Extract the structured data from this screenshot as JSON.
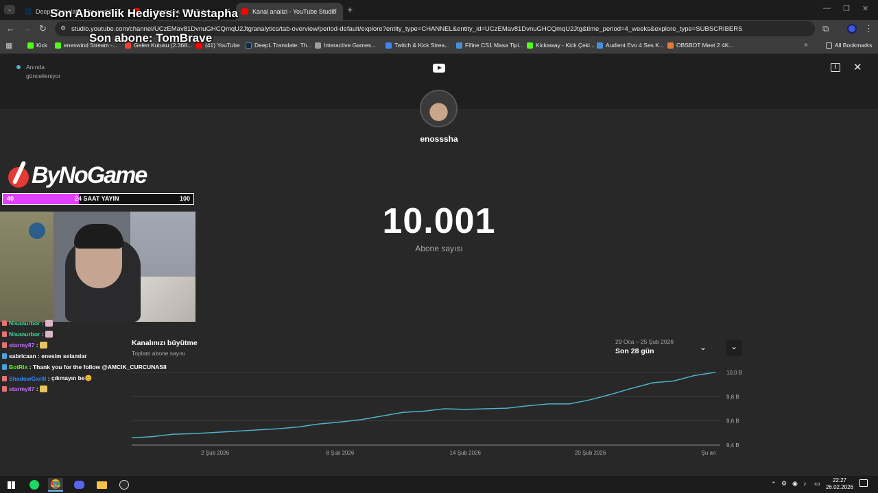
{
  "browser": {
    "tabs": [
      {
        "title": "DeepL Translate: The world's ..."
      },
      {
        "title": "(1) enosssha - YouTube"
      },
      {
        "title": "Kanal analizi - YouTube Studio"
      }
    ],
    "url": "studio.youtube.com/channel/UCzEMav81DvnuGHCQmqU2Jtg/analytics/tab-overview/period-default/explore?entity_type=CHANNEL&entity_id=UCzEMav81DvnuGHCQmqU2Jtg&time_period=4_weeks&explore_type=SUBSCRIBERS",
    "bookmarks": [
      {
        "label": "Kick",
        "color": "#53fc18"
      },
      {
        "label": "eneswind Stream -...",
        "color": "#53fc18"
      },
      {
        "label": "Gelen Kutusu (2.368...",
        "color": "#ea4335"
      },
      {
        "label": "(41) YouTube",
        "color": "#ff0000"
      },
      {
        "label": "DeepL Translate: Th...",
        "color": "#0f2b46"
      },
      {
        "label": "Interactive Games...",
        "color": "#9aa0a6"
      },
      {
        "label": "Twitch & Kick Strea...",
        "color": "#4285f4"
      },
      {
        "label": "Fifine CS1 Masa Tipi...",
        "color": "#4a90d9"
      },
      {
        "label": "Kickaway - Kick Çeki...",
        "color": "#53fc18"
      },
      {
        "label": "Audient Evo 4 Ses K...",
        "color": "#4a90d9"
      },
      {
        "label": "OBSBOT Meet 2 4K...",
        "color": "#e07b39"
      }
    ],
    "all_bookmarks": "All Bookmarks"
  },
  "studio": {
    "live_label_1": "Anında",
    "live_label_2": "güncelleniyor",
    "channel_name": "enosssha",
    "subscriber_count": "10.001",
    "subscriber_label": "Abone sayısı",
    "card_title": "Kanalınızı büyütme",
    "card_subtitle": "Toplam abone sayısı",
    "date_range": "29 Oca – 25 Şub 2026",
    "period_label": "Son 28 gün"
  },
  "chart_data": {
    "type": "line",
    "title": "Kanalınızı büyütme",
    "x_tick_labels": [
      "2 Şub 2026",
      "8 Şub 2026",
      "14 Şub 2026",
      "20 Şub 2026",
      "Şu an"
    ],
    "y_tick_labels": [
      "10,0 B",
      "9,8 B",
      "9,6 B",
      "9,4 B"
    ],
    "ylim": [
      9400,
      10000
    ],
    "x": [
      "29 Oca",
      "30 Oca",
      "31 Oca",
      "1 Şub",
      "2 Şub",
      "3 Şub",
      "4 Şub",
      "5 Şub",
      "6 Şub",
      "7 Şub",
      "8 Şub",
      "9 Şub",
      "10 Şub",
      "11 Şub",
      "12 Şub",
      "13 Şub",
      "14 Şub",
      "15 Şub",
      "16 Şub",
      "17 Şub",
      "18 Şub",
      "19 Şub",
      "20 Şub",
      "21 Şub",
      "22 Şub",
      "23 Şub",
      "24 Şub",
      "25 Şub",
      "Şu an"
    ],
    "values": [
      9460,
      9470,
      9490,
      9495,
      9505,
      9515,
      9525,
      9535,
      9550,
      9575,
      9590,
      9610,
      9640,
      9670,
      9680,
      9700,
      9695,
      9700,
      9705,
      9725,
      9740,
      9740,
      9775,
      9820,
      9870,
      9915,
      9930,
      9975,
      10001
    ],
    "line_color": "#4fb3c8",
    "grid": true
  },
  "overlay": {
    "gift_text": "Son Abonelik Hediyesi: Wustapha",
    "last_sub_text": "Son abone: TomBrave",
    "brand": "ByNoGame",
    "progress": {
      "current": "40",
      "label": "24 SAAT YAYIN",
      "goal": "100",
      "fraction": 0.4
    },
    "chat": [
      {
        "user": "Nisanurbor",
        "msg": "",
        "color": "#3ddc97",
        "badge": "#e57373",
        "emote": "#d8b6c8"
      },
      {
        "user": "Nisanurbor",
        "msg": "",
        "color": "#3ddc97",
        "badge": "#e57373",
        "emote": "#d8b6c8"
      },
      {
        "user": "starmy87",
        "msg": "",
        "color": "#c26bff",
        "badge": "#e57373",
        "emote": "#e8c45a"
      },
      {
        "user": "sabricaan",
        "msg": "enesim selamlar",
        "color": "#ffffff",
        "badge": "#4aa3df",
        "emote": ""
      },
      {
        "user": "BotRix",
        "msg": "Thank you for the follow @AMCIK_CURCUNASII",
        "color": "#53fc18",
        "badge": "#4aa3df",
        "emote": ""
      },
      {
        "user": "ShadowGxrlll",
        "msg": "çıkmayın be😊",
        "color": "#2e86ff",
        "badge": "#e57373",
        "emote": ""
      },
      {
        "user": "starmy87",
        "msg": "",
        "color": "#c26bff",
        "badge": "#e57373",
        "emote": "#e8c45a"
      }
    ]
  },
  "taskbar": {
    "time": "22:27",
    "date": "26.02.2026"
  }
}
